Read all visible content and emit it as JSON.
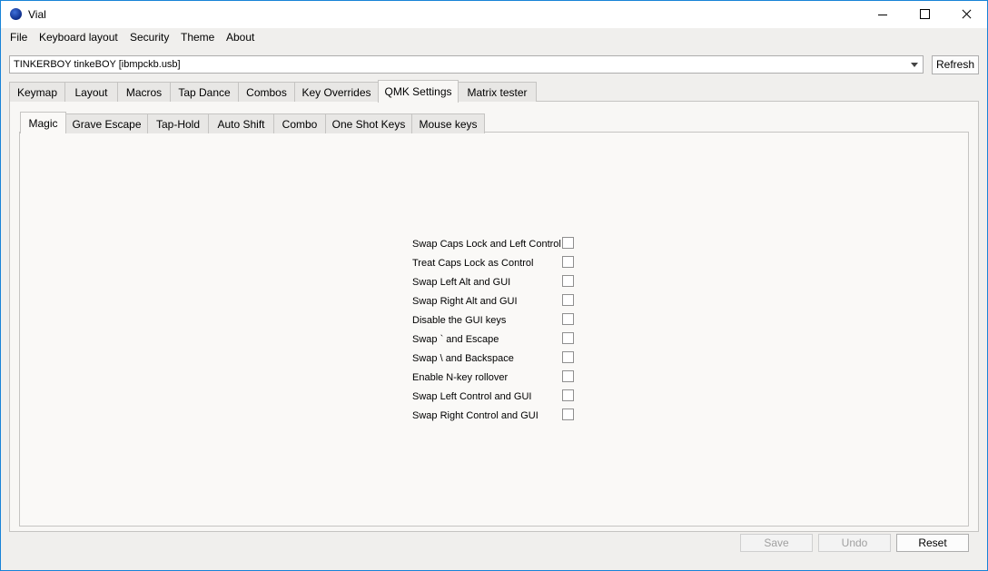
{
  "window": {
    "title": "Vial"
  },
  "menu": [
    "File",
    "Keyboard layout",
    "Security",
    "Theme",
    "About"
  ],
  "device": {
    "selected": "TINKERBOY tinkeBOY [ibmpckb.usb]",
    "refresh_label": "Refresh"
  },
  "tabs": [
    "Keymap",
    "Layout",
    "Macros",
    "Tap Dance",
    "Combos",
    "Key Overrides",
    "QMK Settings",
    "Matrix tester"
  ],
  "active_tab": "QMK Settings",
  "subtabs": [
    "Magic",
    "Grave Escape",
    "Tap-Hold",
    "Auto Shift",
    "Combo",
    "One Shot Keys",
    "Mouse keys"
  ],
  "active_subtab": "Magic",
  "settings": [
    {
      "label": "Swap Caps Lock and Left Control",
      "checked": false
    },
    {
      "label": "Treat Caps Lock as Control",
      "checked": false
    },
    {
      "label": "Swap Left Alt and GUI",
      "checked": false
    },
    {
      "label": "Swap Right Alt and GUI",
      "checked": false
    },
    {
      "label": "Disable the GUI keys",
      "checked": false
    },
    {
      "label": "Swap ` and Escape",
      "checked": false
    },
    {
      "label": "Swap \\ and Backspace",
      "checked": false
    },
    {
      "label": "Enable N-key rollover",
      "checked": false
    },
    {
      "label": "Swap Left Control and GUI",
      "checked": false
    },
    {
      "label": "Swap Right Control and GUI",
      "checked": false
    }
  ],
  "buttons": {
    "save": "Save",
    "undo": "Undo",
    "reset": "Reset"
  }
}
